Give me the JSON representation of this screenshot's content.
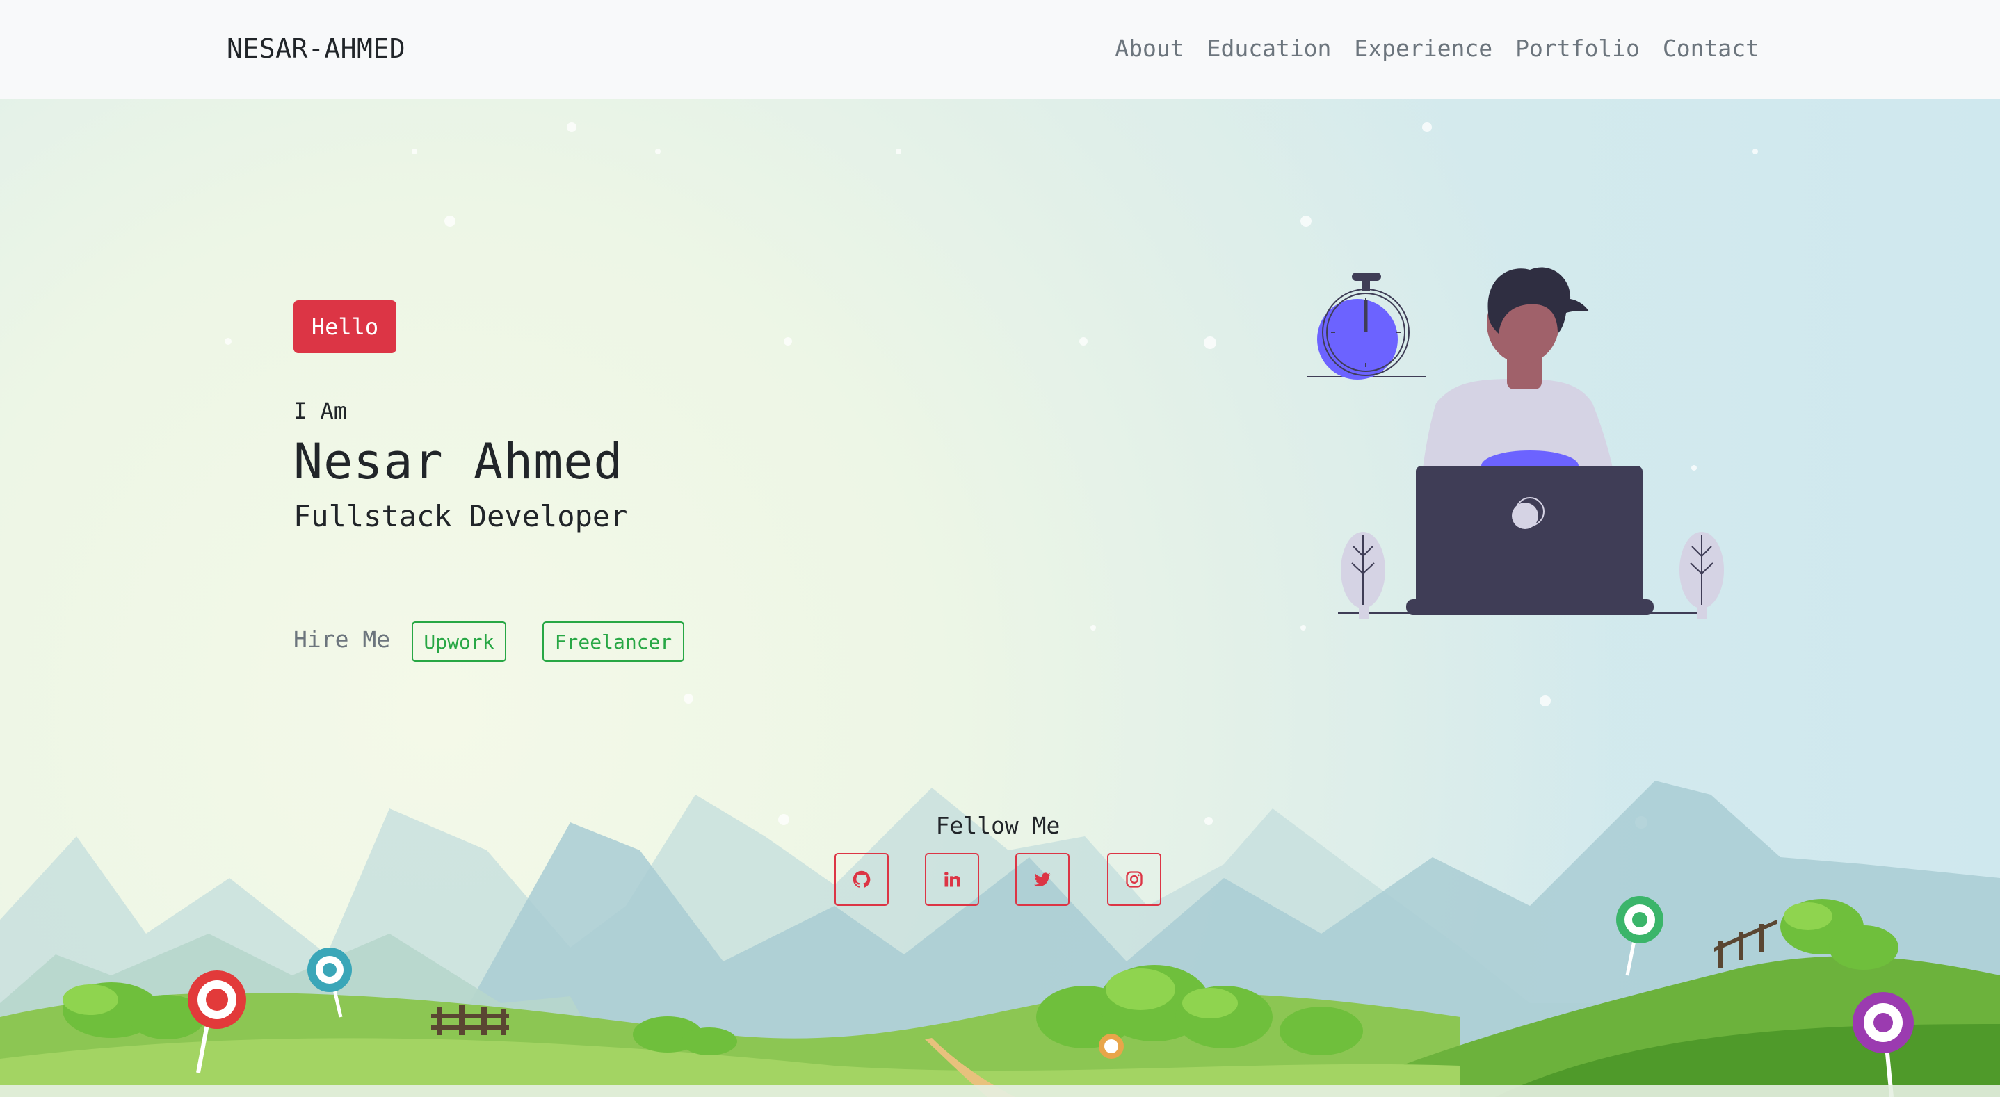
{
  "navbar": {
    "brand": "NESAR-AHMED",
    "links": [
      "About",
      "Education",
      "Experience",
      "Portfolio",
      "Contact"
    ]
  },
  "hero": {
    "badge": "Hello",
    "intro": "I Am",
    "name": "Nesar Ahmed",
    "role": "Fullstack Developer",
    "hire_label": "Hire Me",
    "hire_buttons": [
      "Upwork",
      "Freelancer"
    ]
  },
  "social": {
    "label": "Fellow Me",
    "icons": [
      "github-icon",
      "linkedin-icon",
      "twitter-icon",
      "instagram-icon"
    ]
  },
  "colors": {
    "accent_red": "#dc3545",
    "accent_green": "#28a745",
    "navbar_bg": "#f8f9fa",
    "illustration_blue": "#6c63ff",
    "laptop": "#3f3d56"
  }
}
